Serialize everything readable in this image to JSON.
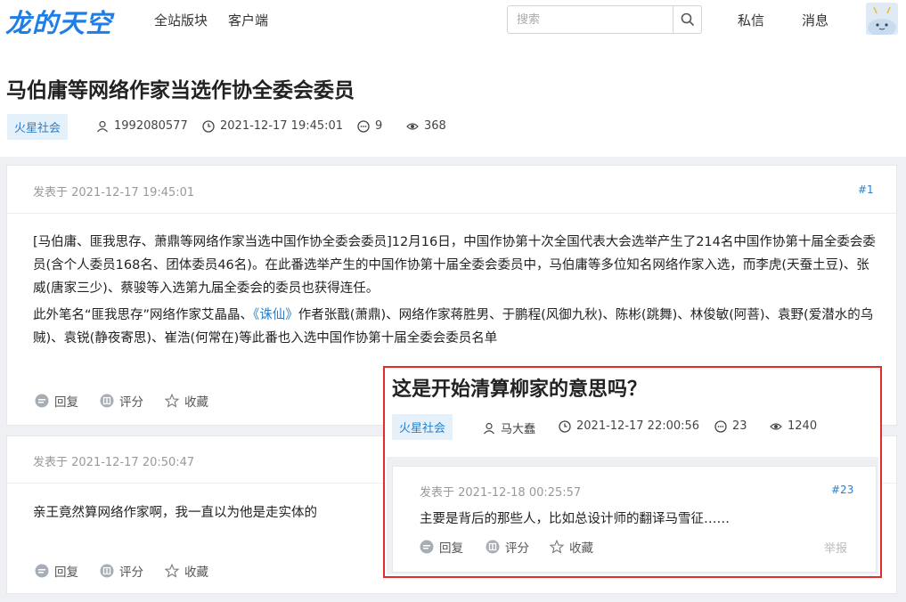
{
  "topbar": {
    "logo": "龙的天空",
    "nav": [
      "全站版块",
      "客户端"
    ],
    "search_placeholder": "搜索",
    "messages_label": "私信",
    "notifications_label": "消息"
  },
  "thread": {
    "title": "马伯庸等网络作家当选作协全委会委员",
    "tag": "火星社会",
    "author": "1992080577",
    "time": "2021-12-17 19:45:01",
    "replies": "9",
    "views": "368"
  },
  "posts": [
    {
      "posted": "发表于 2021-12-17 19:45:01",
      "floor": "#1",
      "p1": "[马伯庸、匪我思存、萧鼎等网络作家当选中国作协全委会委员]12月16日，中国作协第十次全国代表大会选举产生了214名中国作协第十届全委会委员(含个人委员168名、团体委员46名)。在此番选举产生的中国作协第十届全委会委员中，马伯庸等多位知名网络作家入选，而李虎(天蚕土豆)、张威(唐家三少)、蔡骏等入选第九届全委会的委员也获得连任。",
      "p2_before": "此外笔名“匪我思存”网络作家艾晶晶、",
      "p2_link": "《诛仙》",
      "p2_after": "作者张戬(萧鼎)、网络作家蒋胜男、于鹏程(风御九秋)、陈彬(跳舞)、林俊敏(阿菩)、袁野(爱潜水的乌贼)、袁锐(静夜寄思)、崔浩(何常在)等此番也入选中国作协第十届全委会委员名单"
    },
    {
      "posted": "发表于 2021-12-17 20:50:47",
      "text": "亲王竟然算网络作家啊，我一直以为他是走实体的"
    }
  ],
  "actions": {
    "reply": "回复",
    "rate": "评分",
    "favorite": "收藏",
    "report": "举报"
  },
  "overlay": {
    "title": "这是开始清算柳家的意思吗？",
    "tag": "火星社会",
    "author": "马大蠢",
    "time": "2021-12-17 22:00:56",
    "replies": "23",
    "views": "1240",
    "post": {
      "posted": "发表于 2021-12-18 00:25:57",
      "floor": "#23",
      "text": "主要是背后的那些人，比如总设计师的翻译马雪征……"
    }
  },
  "colors": {
    "accent": "#1f7de6",
    "link": "#2a7fc9",
    "highlight_border": "#e32d2d"
  }
}
